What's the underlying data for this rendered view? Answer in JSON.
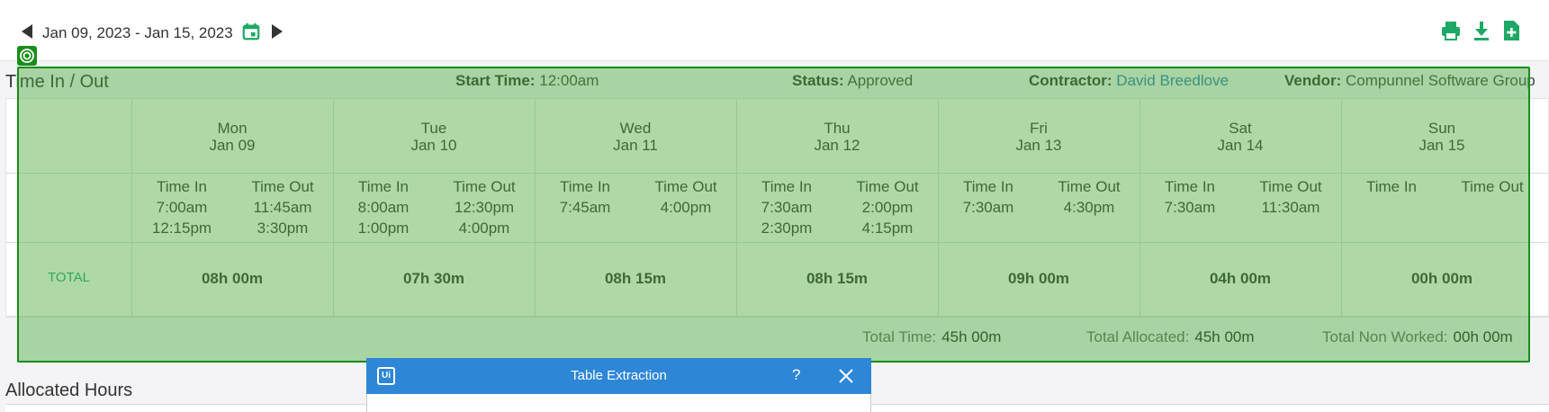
{
  "toolbar": {
    "date_range": "Jan 09, 2023 - Jan 15, 2023",
    "icons": [
      "prev-arrow-icon",
      "calendar-icon",
      "next-arrow-icon",
      "print-icon",
      "download-icon",
      "export-file-icon"
    ],
    "accent_color": "#1ea866"
  },
  "time_section": {
    "title": "Time In / Out",
    "start_time_label": "Start Time:",
    "start_time_value": "12:00am",
    "status_label": "Status:",
    "status_value": "Approved",
    "contractor_label": "Contractor:",
    "contractor_value": "David Breedlove",
    "vendor_label": "Vendor:",
    "vendor_value": "Compunnel Software Group"
  },
  "columns": {
    "time_in": "Time In",
    "time_out": "Time Out"
  },
  "days": [
    {
      "day": "Mon",
      "date": "Jan 09",
      "time_in": [
        "7:00am",
        "12:15pm"
      ],
      "time_out": [
        "11:45am",
        "3:30pm"
      ],
      "total": "08h 00m"
    },
    {
      "day": "Tue",
      "date": "Jan 10",
      "time_in": [
        "8:00am",
        "1:00pm"
      ],
      "time_out": [
        "12:30pm",
        "4:00pm"
      ],
      "total": "07h 30m"
    },
    {
      "day": "Wed",
      "date": "Jan 11",
      "time_in": [
        "7:45am",
        ""
      ],
      "time_out": [
        "4:00pm",
        ""
      ],
      "total": "08h 15m"
    },
    {
      "day": "Thu",
      "date": "Jan 12",
      "time_in": [
        "7:30am",
        "2:30pm"
      ],
      "time_out": [
        "2:00pm",
        "4:15pm"
      ],
      "total": "08h 15m"
    },
    {
      "day": "Fri",
      "date": "Jan 13",
      "time_in": [
        "7:30am",
        ""
      ],
      "time_out": [
        "4:30pm",
        ""
      ],
      "total": "09h 00m"
    },
    {
      "day": "Sat",
      "date": "Jan 14",
      "time_in": [
        "7:30am",
        ""
      ],
      "time_out": [
        "11:30am",
        ""
      ],
      "total": "04h 00m"
    },
    {
      "day": "Sun",
      "date": "Jan 15",
      "time_in": [
        "",
        ""
      ],
      "time_out": [
        "",
        ""
      ],
      "total": "00h 00m"
    }
  ],
  "total_label": "TOTAL",
  "summary": {
    "total_time_label": "Total Time:",
    "total_time_value": "45h 00m",
    "total_allocated_label": "Total Allocated:",
    "total_allocated_value": "45h 00m",
    "total_non_worked_label": "Total Non Worked:",
    "total_non_worked_value": "00h 00m"
  },
  "allocated_section": {
    "title": "Allocated Hours"
  },
  "dialog": {
    "logo": "Ui",
    "title": "Table Extraction",
    "help": "?",
    "header_color": "#2e86d6"
  },
  "overlay": {
    "color": "#1a8c1a"
  }
}
